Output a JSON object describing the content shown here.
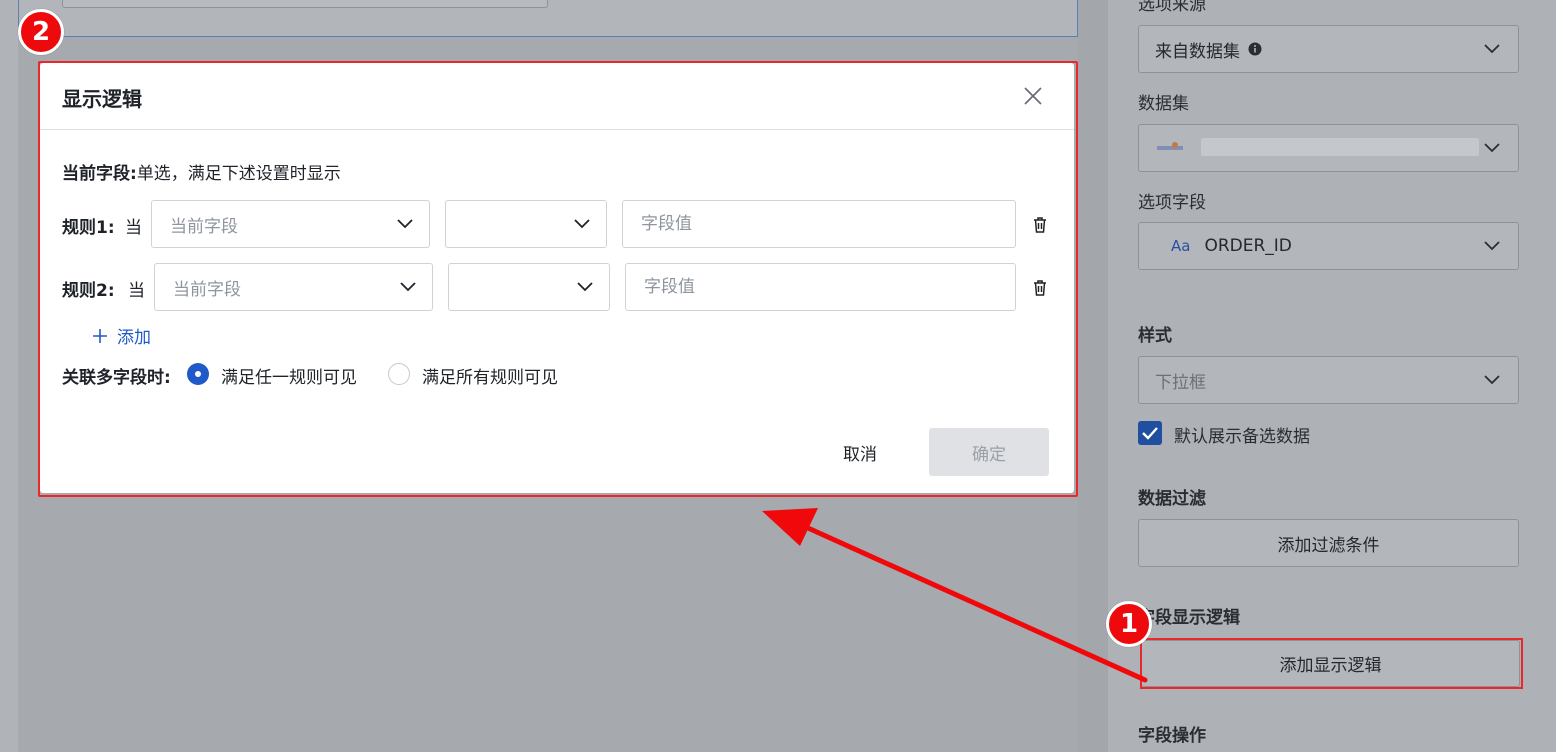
{
  "background_panel": {
    "option_source_label": "选项来源",
    "option_source_value": "来自数据集",
    "dataset_label": "数据集",
    "dataset_value": "",
    "option_field_label": "选项字段",
    "option_field_type_icon": "Aa",
    "option_field_value": "ORDER_ID",
    "style_label": "样式",
    "style_value": "下拉框",
    "default_show_label": "默认展示备选数据",
    "data_filter_label": "数据过滤",
    "add_filter_button": "添加过滤条件",
    "field_display_logic_label": "字段显示逻辑",
    "add_display_logic_button": "添加显示逻辑",
    "field_actions_label": "字段操作"
  },
  "modal": {
    "title": "显示逻辑",
    "current_field_prefix": "当前字段:",
    "current_field_desc": "单选，满足下述设置时显示",
    "rules": [
      {
        "label": "规则1:",
        "when": "当",
        "field_placeholder": "当前字段",
        "operator_value": "",
        "value_placeholder": "字段值"
      },
      {
        "label": "规则2:",
        "when": "当",
        "field_placeholder": "当前字段",
        "operator_value": "",
        "value_placeholder": "字段值"
      }
    ],
    "add_label": "添加",
    "multi_field_label": "关联多字段时:",
    "radio_options": [
      {
        "label": "满足任一规则可见",
        "selected": true
      },
      {
        "label": "满足所有规则可见",
        "selected": false
      }
    ],
    "cancel_label": "取消",
    "ok_label": "确定"
  },
  "annotations": {
    "badge_1": "1",
    "badge_2": "2"
  },
  "colors": {
    "accent": "#1f5ac8",
    "annotation_red": "#e8282b",
    "disabled_button": "#dfe1e5"
  }
}
